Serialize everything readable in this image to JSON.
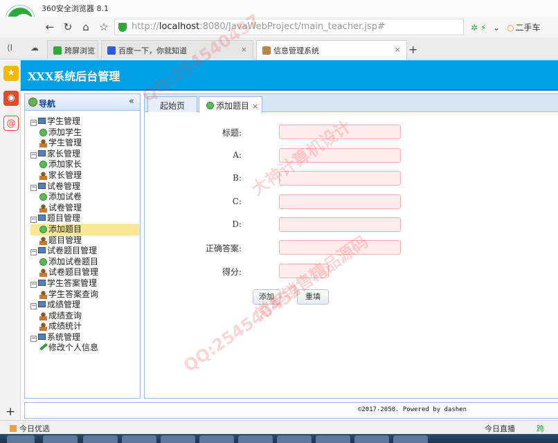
{
  "browser": {
    "app_title": "360安全浏览器 8.1",
    "url_host": "http://",
    "url_main": "localhost",
    "url_rest": ":8080/JavaWebProject/main_teacher.jsp#",
    "addr_right_text": "二手车",
    "tabs": [
      {
        "label": "跨屏浏览"
      },
      {
        "label": "百度一下，你就知道"
      },
      {
        "label": "信息管理系统"
      }
    ],
    "status_left": "今日优选",
    "status_right": "今日直播",
    "status_right2": "跨"
  },
  "app": {
    "header_title": "XXX系统后台管理",
    "nav_title": "导航",
    "collapse_glyph": "«",
    "tree": [
      {
        "label": "学生管理",
        "children": [
          {
            "label": "添加学生",
            "icon": "add"
          },
          {
            "label": "学生管理",
            "icon": "user"
          }
        ]
      },
      {
        "label": "家长管理",
        "children": [
          {
            "label": "添加家长",
            "icon": "add"
          },
          {
            "label": "家长管理",
            "icon": "user"
          }
        ]
      },
      {
        "label": "试卷管理",
        "children": [
          {
            "label": "添加试卷",
            "icon": "add"
          },
          {
            "label": "试卷管理",
            "icon": "user"
          }
        ]
      },
      {
        "label": "题目管理",
        "children": [
          {
            "label": "添加题目",
            "icon": "add",
            "selected": true
          },
          {
            "label": "题目管理",
            "icon": "user"
          }
        ]
      },
      {
        "label": "试卷题目管理",
        "children": [
          {
            "label": "添加试卷题目",
            "icon": "add"
          },
          {
            "label": "试卷题目管理",
            "icon": "user"
          }
        ]
      },
      {
        "label": "学生答案管理",
        "children": [
          {
            "label": "学生答案查询",
            "icon": "user"
          }
        ]
      },
      {
        "label": "成绩管理",
        "children": [
          {
            "label": "成绩查询",
            "icon": "user"
          },
          {
            "label": "成绩统计",
            "icon": "user"
          }
        ]
      },
      {
        "label": "系统管理",
        "children": [
          {
            "label": "修改个人信息",
            "icon": "pen"
          }
        ]
      }
    ],
    "panel_tabs": [
      {
        "label": "起始页"
      },
      {
        "label": "添加题目",
        "close": "×"
      }
    ],
    "form": {
      "fields": [
        {
          "label": "标题:",
          "value": ""
        },
        {
          "label": "A:",
          "value": ""
        },
        {
          "label": "B:",
          "value": ""
        },
        {
          "label": "C:",
          "value": ""
        },
        {
          "label": "D:",
          "value": ""
        },
        {
          "label": "正确答案:",
          "value": ""
        },
        {
          "label": "得分:",
          "value": ""
        }
      ],
      "submit_label": "添加",
      "reset_label": "重填"
    },
    "footer_text": "©2017-2050. Powered by dashen"
  },
  "watermarks": {
    "qq": "QQ:254540457",
    "seller": "常年销售精品源码",
    "designer": "大神计算机设计"
  },
  "colors": {
    "header_bg": "#00a0e6",
    "input_bg": "#ffecec",
    "selected_row": "#fbe79a",
    "panel_border": "#99bbe8"
  }
}
